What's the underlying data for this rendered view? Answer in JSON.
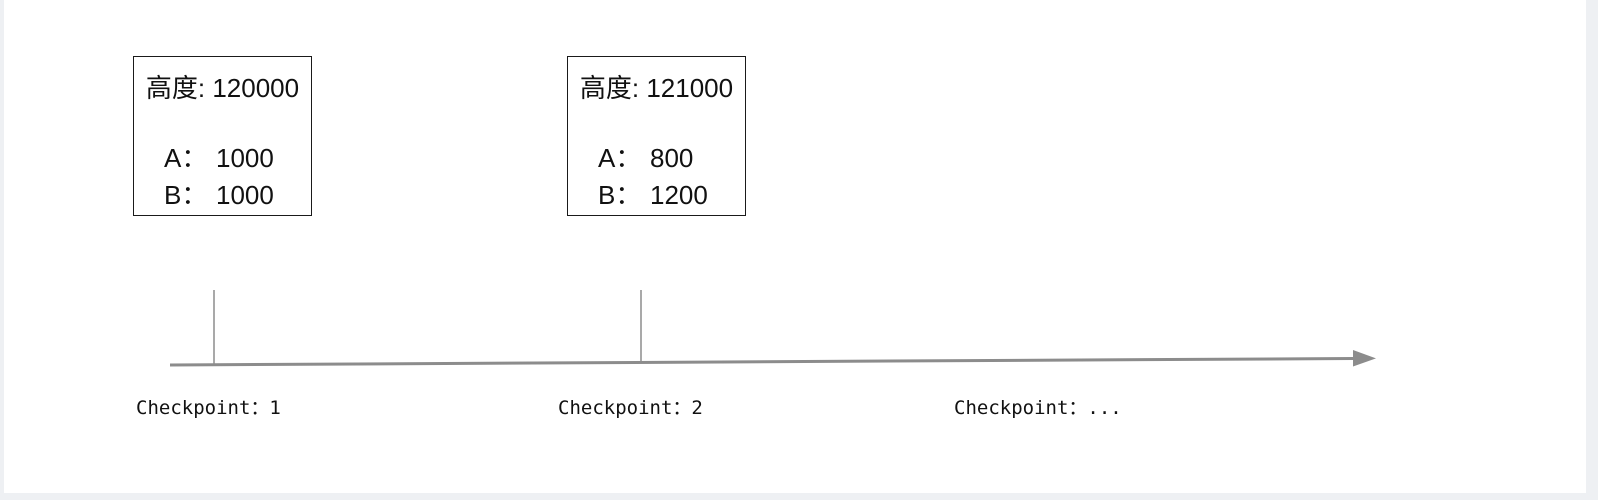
{
  "checkpoints": [
    {
      "label": "Checkpoint：1",
      "height": "高度: 120000",
      "balances": [
        {
          "key": "A：",
          "value": "1000"
        },
        {
          "key": "B：",
          "value": "1000"
        }
      ]
    },
    {
      "label": "Checkpoint：2",
      "height": "高度: 121000",
      "balances": [
        {
          "key": "A：",
          "value": "800"
        },
        {
          "key": "B：",
          "value": "1200"
        }
      ]
    },
    {
      "label": "Checkpoint：..."
    }
  ],
  "colors": {
    "axis": "#8c8c8c",
    "box_border": "#1a1a1a",
    "text": "#111111",
    "page_background": "#eef0f3",
    "canvas_background": "#ffffff"
  }
}
